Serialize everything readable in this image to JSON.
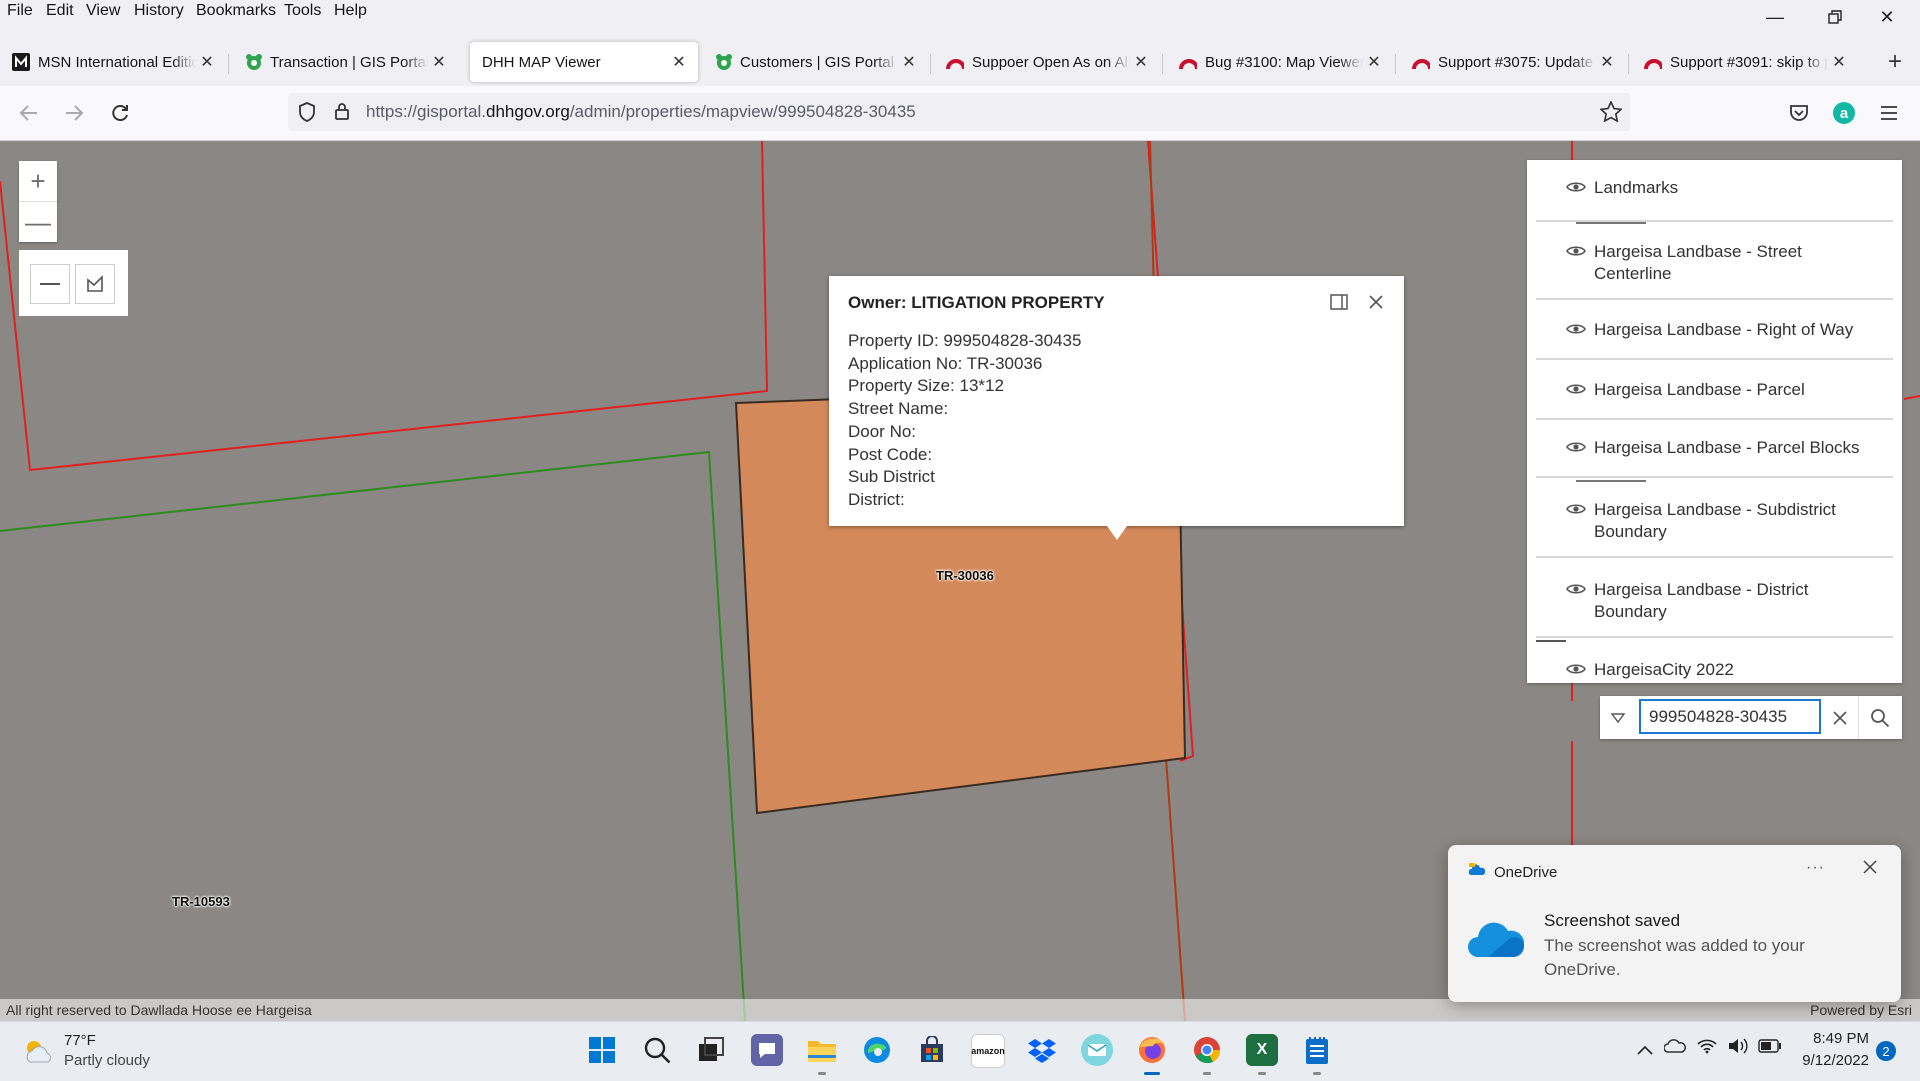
{
  "menubar": {
    "items": [
      {
        "label": "File"
      },
      {
        "label": "Edit"
      },
      {
        "label": "View"
      },
      {
        "label": "History"
      },
      {
        "label": "Bookmarks"
      },
      {
        "label": "Tools"
      },
      {
        "label": "Help"
      }
    ]
  },
  "tabs": [
    {
      "label": "MSN International Edition",
      "icon": "msn-icon"
    },
    {
      "label": "Transaction | GIS Portal",
      "icon": "gis-portal-icon"
    },
    {
      "label": "DHH MAP Viewer",
      "icon": "none",
      "active": true
    },
    {
      "label": "Customers | GIS Portal",
      "icon": "gis-portal-icon"
    },
    {
      "label": "Suppoer Open As on All",
      "icon": "redmine-icon"
    },
    {
      "label": "Bug #3100: Map Viewer",
      "icon": "redmine-icon"
    },
    {
      "label": "Support #3075: Update",
      "icon": "redmine-icon"
    },
    {
      "label": "Support #3091: skip to p",
      "icon": "redmine-icon"
    }
  ],
  "nav": {
    "url_prefix": "https://gisportal.",
    "url_domain": "dhhgov.org",
    "url_path": "/admin/properties/mapview/999504828-30435"
  },
  "map": {
    "parcel_labels": [
      "TR-30036",
      "TR-10593"
    ],
    "attribution_left": "All right reserved to Dawllada Hoose ee Hargeisa",
    "attribution_right": "Powered by Esri"
  },
  "popup": {
    "title": "Owner: LITIGATION PROPERTY",
    "lines": [
      "Property ID: 999504828-30435",
      "Application No: TR-30036",
      "Property Size: 13*12",
      "Street Name:",
      "Door No:",
      "Post Code:",
      "Sub District",
      "District:"
    ]
  },
  "layers": [
    {
      "label": "Landmarks"
    },
    {
      "label": "Hargeisa Landbase - Street Centerline"
    },
    {
      "label": "Hargeisa Landbase - Right of Way"
    },
    {
      "label": "Hargeisa Landbase - Parcel"
    },
    {
      "label": "Hargeisa Landbase - Parcel Blocks"
    },
    {
      "label": "Hargeisa Landbase - Subdistrict Boundary"
    },
    {
      "label": "Hargeisa Landbase - District Boundary"
    },
    {
      "label": "HargeisaCity 2022"
    }
  ],
  "search": {
    "value": "999504828-30435"
  },
  "toast": {
    "app": "OneDrive",
    "title": "Screenshot saved",
    "body": "The screenshot was added to your OneDrive."
  },
  "taskbar": {
    "weather_temp": "77°F",
    "weather_desc": "Partly cloudy",
    "time": "8:49 PM",
    "date": "9/12/2022",
    "notification_count": "2"
  },
  "colors": {
    "parcel_fill": "#d4895a",
    "parcel_red": "#e02020",
    "parcel_green": "#2e8b1e",
    "map_bg": "#8a8784",
    "accent": "#1e78d2"
  }
}
